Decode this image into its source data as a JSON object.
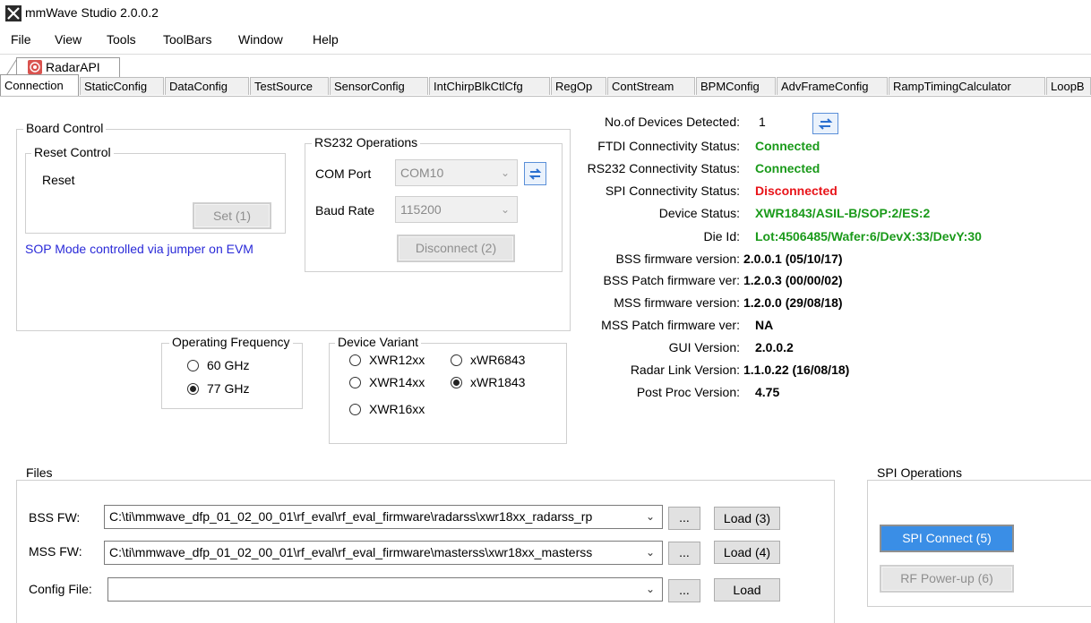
{
  "window": {
    "title": "mmWave Studio 2.0.0.2"
  },
  "menu": [
    "File",
    "View",
    "Tools",
    "ToolBars",
    "Window",
    "Help"
  ],
  "doc_tab": {
    "label": "RadarAPI"
  },
  "tabs": [
    "Connection",
    "StaticConfig",
    "DataConfig",
    "TestSource",
    "SensorConfig",
    "IntChirpBlkCtlCfg",
    "RegOp",
    "ContStream",
    "BPMConfig",
    "AdvFrameConfig",
    "RampTimingCalculator",
    "LoopB"
  ],
  "board_control": {
    "title": "Board Control",
    "reset_control_title": "Reset Control",
    "reset_label": "Reset",
    "set_button": "Set (1)",
    "sop_note": "SOP Mode controlled via jumper on EVM"
  },
  "rs232": {
    "title": "RS232 Operations",
    "com_port_label": "COM Port",
    "com_port_value": "COM10",
    "baud_rate_label": "Baud Rate",
    "baud_rate_value": "115200",
    "disconnect_button": "Disconnect (2)"
  },
  "frequency": {
    "title": "Operating Frequency",
    "options": [
      "60 GHz",
      "77 GHz"
    ],
    "selected": "77 GHz"
  },
  "device_variant": {
    "title": "Device Variant",
    "options": [
      "XWR12xx",
      "xWR6843",
      "XWR14xx",
      "xWR1843",
      "XWR16xx"
    ],
    "selected": "xWR1843"
  },
  "status": {
    "rows": [
      {
        "label": "No.of Devices Detected:",
        "value": "1"
      },
      {
        "label": "FTDI Connectivity Status:",
        "value": "Connected"
      },
      {
        "label": "RS232 Connectivity Status:",
        "value": "Connected"
      },
      {
        "label": "SPI Connectivity Status:",
        "value": "Disconnected"
      },
      {
        "label": "Device Status:",
        "value": "XWR1843/ASIL-B/SOP:2/ES:2"
      },
      {
        "label": "Die Id:",
        "value": "Lot:4506485/Wafer:6/DevX:33/DevY:30"
      },
      {
        "label": "BSS firmware version:",
        "value": "2.0.0.1 (05/10/17)"
      },
      {
        "label": "BSS Patch firmware ver:",
        "value": "1.2.0.3 (00/00/02)"
      },
      {
        "label": "MSS firmware version:",
        "value": "1.2.0.0 (29/08/18)"
      },
      {
        "label": "MSS Patch firmware ver:",
        "value": "NA"
      },
      {
        "label": "GUI Version:",
        "value": "2.0.0.2"
      },
      {
        "label": "Radar Link Version:",
        "value": "1.1.0.22 (16/08/18)"
      },
      {
        "label": "Post Proc Version:",
        "value": "4.75"
      }
    ],
    "colors": {
      "connected": "#1a9a1a",
      "disconnected": "#e8141a",
      "device": "#1a9a1a",
      "default": "#000000"
    }
  },
  "files": {
    "title": "Files",
    "bss_label": "BSS FW:",
    "bss_path": "C:\\ti\\mmwave_dfp_01_02_00_01\\rf_eval\\rf_eval_firmware\\radarss\\xwr18xx_radarss_rp",
    "bss_load": "Load (3)",
    "mss_label": "MSS FW:",
    "mss_path": "C:\\ti\\mmwave_dfp_01_02_00_01\\rf_eval\\rf_eval_firmware\\masterss\\xwr18xx_masterss",
    "mss_load": "Load (4)",
    "config_label": "Config File:",
    "config_path": "",
    "config_load": "Load",
    "browse": "..."
  },
  "spi": {
    "title": "SPI Operations",
    "connect_button": "SPI Connect (5)",
    "powerup_button": "RF Power-up (6)"
  },
  "accent_color": "#3a8ee6"
}
